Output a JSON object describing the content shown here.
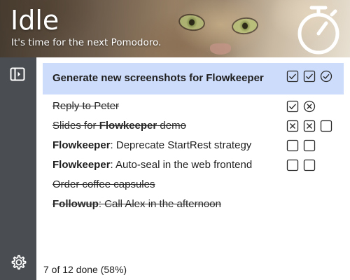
{
  "header": {
    "title": "Idle",
    "subtitle": "It's time for the next Pomodoro.",
    "background": "cat-photo",
    "action_icon": "stopwatch-icon"
  },
  "sidebar": {
    "top_icon": "toggle-panel-icon",
    "bottom_icon": "gear-icon",
    "background": "#4a4e52"
  },
  "tasks": [
    {
      "title": "Generate new screenshots for Flowkeeper",
      "bold": "",
      "done": false,
      "selected": true,
      "pomodoros": [
        "completed",
        "completed",
        "running"
      ]
    },
    {
      "title": "Reply to Peter",
      "bold": "",
      "done": true,
      "selected": false,
      "pomodoros": [
        "completed",
        "voided"
      ]
    },
    {
      "title": "Slides for Flowkeeper demo",
      "bold": "Flowkeeper",
      "done": true,
      "selected": false,
      "pomodoros": [
        "canceled",
        "canceled",
        "new"
      ]
    },
    {
      "title": "Flowkeeper: Deprecate StartRest strategy",
      "bold": "Flowkeeper",
      "done": false,
      "selected": false,
      "pomodoros": [
        "new",
        "new"
      ]
    },
    {
      "title": "Flowkeeper: Auto-seal in the web frontend",
      "bold": "Flowkeeper",
      "done": false,
      "selected": false,
      "pomodoros": [
        "new",
        "new"
      ]
    },
    {
      "title": "Order coffee capsules",
      "bold": "",
      "done": true,
      "selected": false,
      "pomodoros": []
    },
    {
      "title": "Followup: Call Alex in the afternoon",
      "bold": "Followup",
      "done": true,
      "selected": false,
      "pomodoros": []
    }
  ],
  "status": {
    "text": "7 of 12 done (58%)"
  },
  "colors": {
    "selection": "#cddcfb",
    "sidebar": "#4a4e52",
    "text": "#1e1e1e",
    "icon_stroke": "#2a2a2a"
  }
}
